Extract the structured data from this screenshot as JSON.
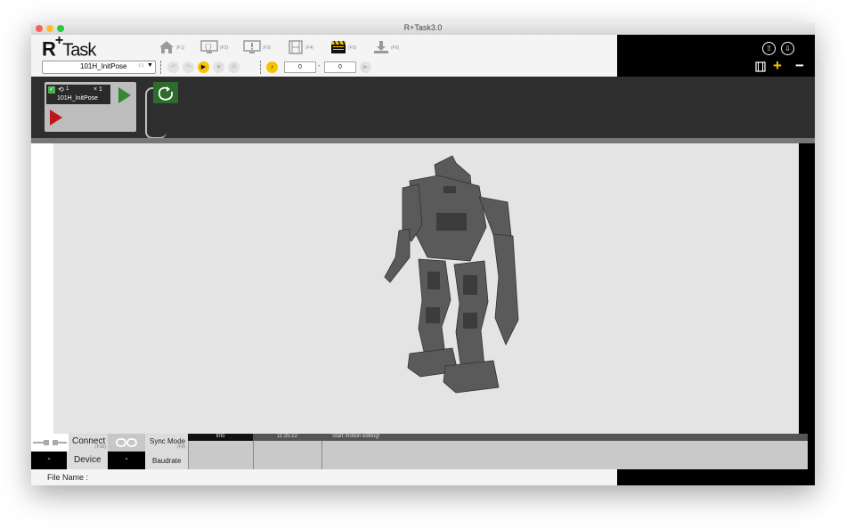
{
  "window": {
    "title": "R+Task3.0"
  },
  "app": {
    "logo_r": "R",
    "logo_plus": "+",
    "logo_task": "Task"
  },
  "toolbar": {
    "function_keys": [
      {
        "icon": "home-icon",
        "key": "(F1)"
      },
      {
        "icon": "code-screen-icon",
        "key": "(F2)"
      },
      {
        "icon": "alert-screen-icon",
        "key": "(F3)"
      },
      {
        "icon": "film-icon",
        "key": "(F4)"
      },
      {
        "icon": "clapperboard-icon",
        "key": "(F5)"
      },
      {
        "icon": "download-icon",
        "key": "(F6)"
      }
    ],
    "motion_select": "101H_InitPose",
    "motion_select_suffix": "(-)",
    "start_value": "0",
    "separator": "-",
    "end_value": "0"
  },
  "motion_card": {
    "repeat_count": "1",
    "times": "× 1",
    "name": "101H_InitPose"
  },
  "status": {
    "connect_label": "Connect",
    "connect_key": "(F10)",
    "sync_label": "Sync Mode",
    "sync_key": "(F9)",
    "device_value": "-",
    "device_label": "Device",
    "baud_value": "-",
    "baud_label": "Baudrate"
  },
  "log": {
    "header": "Info",
    "time": "11:35:22",
    "message": "Start motion editing!"
  },
  "footer": {
    "file_name_label": "File Name :"
  },
  "colors": {
    "accent_yellow": "#f5c400",
    "play_green": "#2e8b2e",
    "stop_red": "#c0141c"
  }
}
